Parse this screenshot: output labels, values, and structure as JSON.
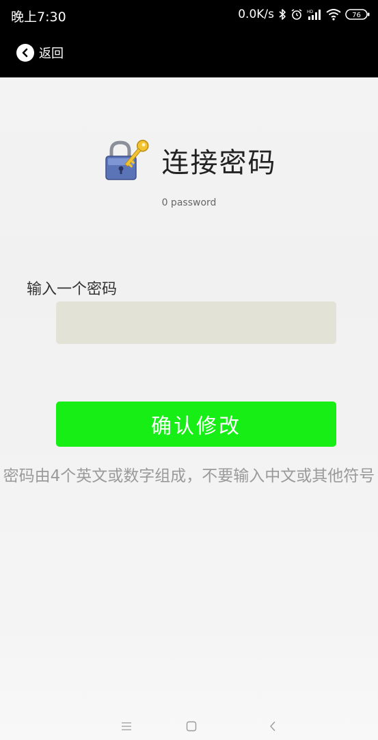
{
  "status_bar": {
    "time": "晚上7:30",
    "net_speed": "0.0K/s",
    "battery": "76",
    "icons": [
      "bluetooth-icon",
      "alarm-icon",
      "hd-signal-icon",
      "wifi-icon",
      "battery-icon"
    ]
  },
  "nav": {
    "back_label": "返回"
  },
  "header": {
    "title": "连接密码",
    "subtitle": "0 password",
    "icon": "lock-key-icon"
  },
  "form": {
    "label": "输入一个密码",
    "password_value": "",
    "confirm_label": "确认修改",
    "hint": "密码由4个英文或数字组成，不要输入中文或其他符号"
  },
  "colors": {
    "confirm_button": "#16ee16",
    "input_background": "#e3e2d6",
    "top_bar": "#000000"
  },
  "system_nav": {
    "buttons": [
      "menu-icon",
      "home-icon",
      "back-icon"
    ]
  }
}
